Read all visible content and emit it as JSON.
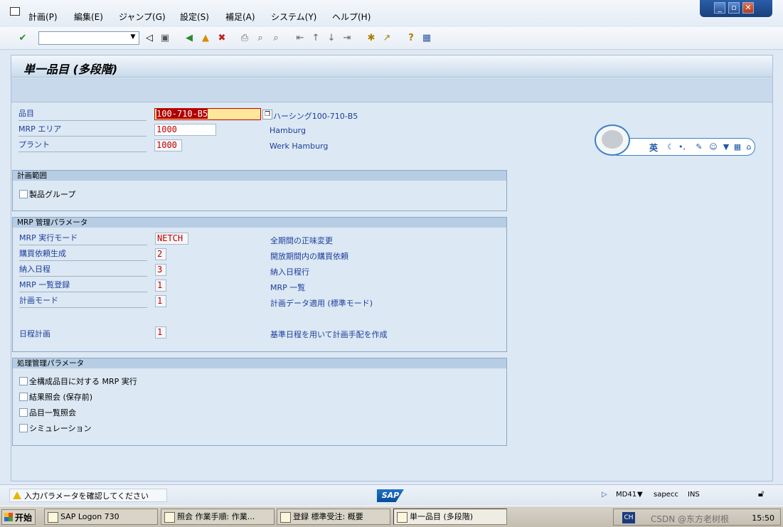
{
  "menu": {
    "items": [
      "計画(P)",
      "編集(E)",
      "ジャンプ(G)",
      "設定(S)",
      "補足(A)",
      "システム(Y)",
      "ヘルプ(H)"
    ]
  },
  "window_controls": {
    "minimize": "_",
    "restore": "▫",
    "close": "✕"
  },
  "toolbar": {
    "command_value": "",
    "icons": [
      "check-icon",
      "back-triangle-icon",
      "save-icon",
      "back-icon",
      "exit-icon",
      "cancel-icon",
      "print-icon",
      "find-icon",
      "find-next-icon",
      "first-page-icon",
      "prev-page-icon",
      "next-page-icon",
      "last-page-icon",
      "new-session-icon",
      "shortcut-icon",
      "help-icon",
      "layout-icon"
    ]
  },
  "page": {
    "title": "単一品目 (多段階)"
  },
  "header_fields": [
    {
      "label": "品目",
      "value": "100-710-B5",
      "desc": "ハーシング100-710-B5"
    },
    {
      "label": "MRP エリア",
      "value": "1000",
      "desc": "Hamburg"
    },
    {
      "label": "プラント",
      "value": "1000",
      "desc": "Werk Hamburg"
    }
  ],
  "group_scope": {
    "title": "計画範囲",
    "checkbox": "製品グループ"
  },
  "group_mrp": {
    "title": "MRP 管理パラメータ",
    "rows": [
      {
        "label": "MRP 実行モード",
        "value": "NETCH",
        "desc": "全期間の正味変更"
      },
      {
        "label": "購買依頼生成",
        "value": "2",
        "desc": "開放期間内の購買依頼"
      },
      {
        "label": "納入日程",
        "value": "3",
        "desc": "納入日程行"
      },
      {
        "label": "MRP 一覧登録",
        "value": "1",
        "desc": "MRP 一覧"
      },
      {
        "label": "計画モード",
        "value": "1",
        "desc": "計画データ適用 (標準モード)"
      },
      {
        "label": "日程計画",
        "value": "1",
        "desc": "基準日程を用いて計画手配を作成"
      }
    ]
  },
  "group_process": {
    "title": "処理管理パラメータ",
    "checkboxes": [
      "全構成品目に対する MRP 実行",
      "結果照会 (保存前)",
      "品目一覧照会",
      "シミュレーション"
    ]
  },
  "ime": {
    "lang": "英"
  },
  "status": {
    "message": "入力パラメータを確認してください",
    "logo": "SAP",
    "transaction": "MD41",
    "server": "sapecc",
    "mode": "INS"
  },
  "taskbar": {
    "start": "开始",
    "tasks": [
      "SAP Logon 730",
      "照会 作業手順: 作業...",
      "登録 標準受注: 概要",
      "単一品目 (多段階)"
    ],
    "tray_lang": "CH",
    "watermark": "CSDN @东方老树根",
    "clock": "15:50"
  }
}
